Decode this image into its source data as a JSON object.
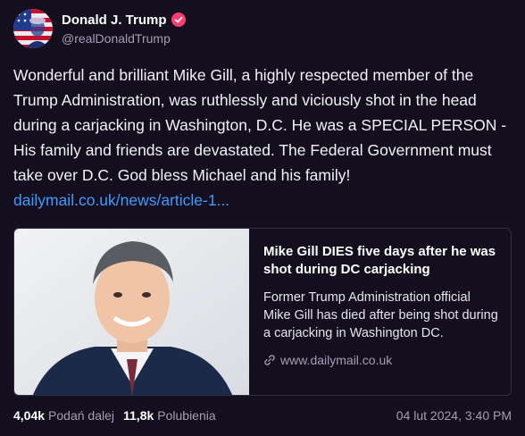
{
  "author": {
    "display_name": "Donald J. Trump",
    "handle": "@realDonaldTrump",
    "verified_icon": "verified-badge-icon",
    "avatar_icon": "avatar-flag-portrait"
  },
  "post": {
    "text": "Wonderful and brilliant Mike Gill, a highly respected member of the Trump Administration, was ruthlessly and viciously shot in the head during a carjacking in Washington, D.C. He was a SPECIAL PERSON - His family and friends are devastated. The Federal Government must take over D.C. God bless Michael and his family!",
    "link_text": "dailymail.co.uk/news/article-1..."
  },
  "link_card": {
    "title": "Mike Gill DIES five days after he was shot during DC carjacking",
    "description": "Former Trump Administration official Mike Gill has died after being shot during a carjacking in Washington DC.",
    "domain": "www.dailymail.co.uk",
    "domain_icon": "link-icon",
    "image_icon": "portrait-photo"
  },
  "stats": {
    "reshares_count": "4,04k",
    "reshares_label": "Podań dalej",
    "likes_count": "11,8k",
    "likes_label": "Polubienia",
    "timestamp": "04 lut 2024, 3:40 PM"
  },
  "colors": {
    "background": "#140f1f",
    "link": "#3f9bff",
    "muted": "#a49fb3",
    "verified": "#ff3c6f"
  }
}
